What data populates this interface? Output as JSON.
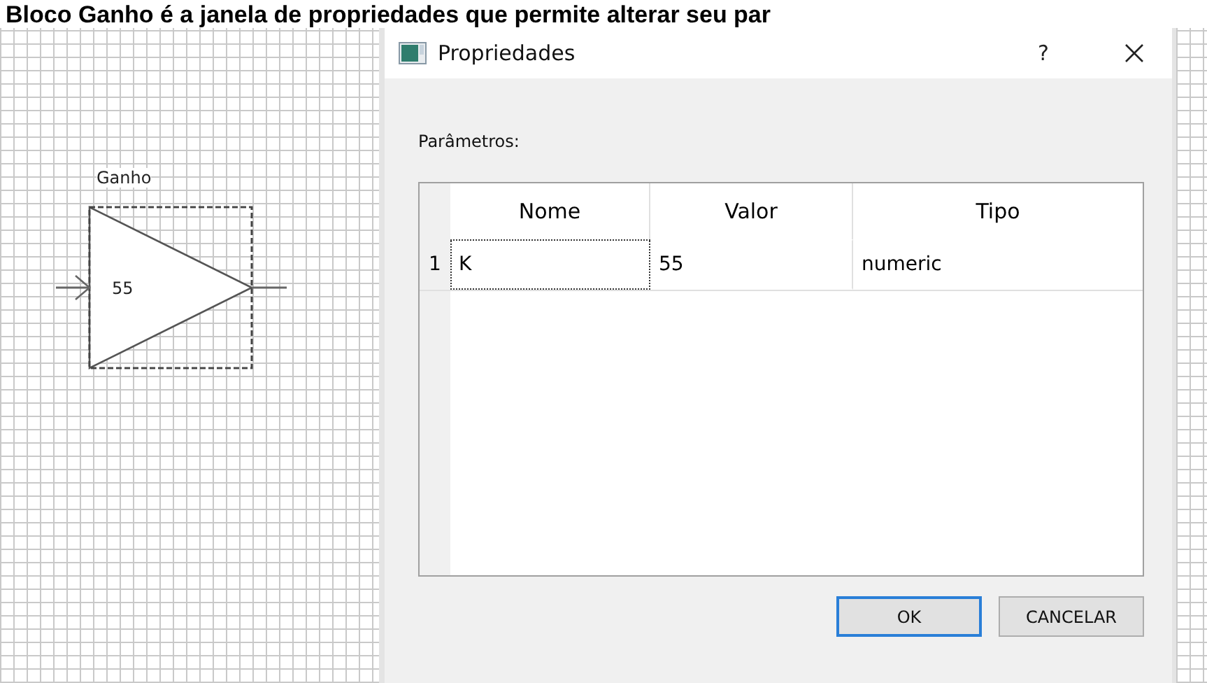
{
  "caption": "Bloco Ganho é a janela de propriedades que permite alterar seu par",
  "block": {
    "label": "Ganho",
    "value": "55"
  },
  "dialog": {
    "title": "Propriedades",
    "help": "?",
    "section_label": "Parâmetros:",
    "table": {
      "columns": [
        "Nome",
        "Valor",
        "Tipo"
      ],
      "rows": [
        {
          "number": "1",
          "cells": [
            {
              "text": "K",
              "focused": true
            },
            {
              "text": "55",
              "focused": false
            },
            {
              "text": "numeric",
              "focused": false
            }
          ]
        }
      ]
    },
    "buttons": [
      {
        "label": "OK",
        "default": true
      },
      {
        "label": "CANCELAR",
        "default": false
      }
    ]
  }
}
